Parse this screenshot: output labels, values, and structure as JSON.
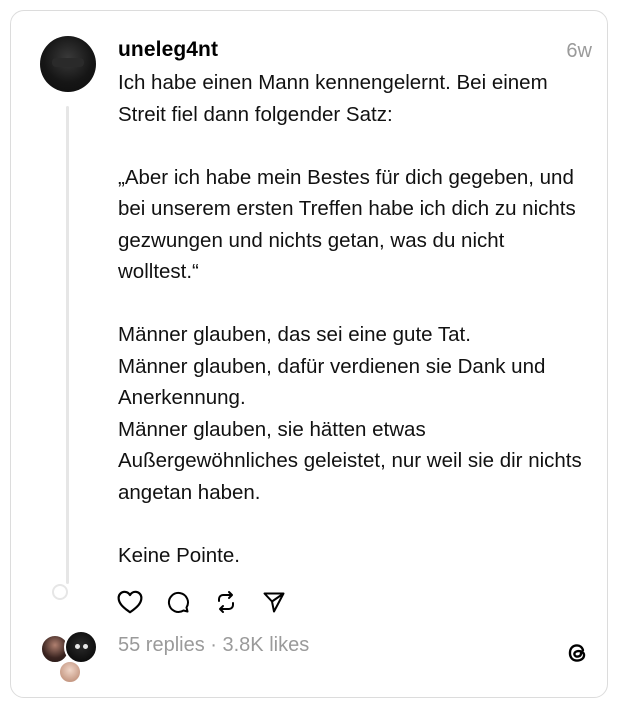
{
  "post": {
    "username": "uneleg4nt",
    "timestamp": "6w",
    "paragraphs": [
      "Ich habe einen Mann kennengelernt. Bei einem Streit fiel dann folgender Satz:",
      "„Aber ich habe mein Bestes für dich gegeben, und bei unserem ersten Treffen habe ich dich zu nichts gezwungen und nichts getan, was du nicht wolltest.“",
      "Männer glauben, das sei eine gute Tat.\nMänner glauben, dafür verdienen sie Dank und Anerkennung.\nMänner glauben, sie hätten etwas Außergewöhnliches geleistet, nur weil sie dir nichts angetan haben.",
      "Keine Pointe."
    ],
    "actions": [
      "heart-icon",
      "comment-icon",
      "repost-icon",
      "share-icon"
    ],
    "stats": "55 replies · 3.8K likes"
  },
  "icons": {
    "app_logo": "threads-logo-icon"
  }
}
